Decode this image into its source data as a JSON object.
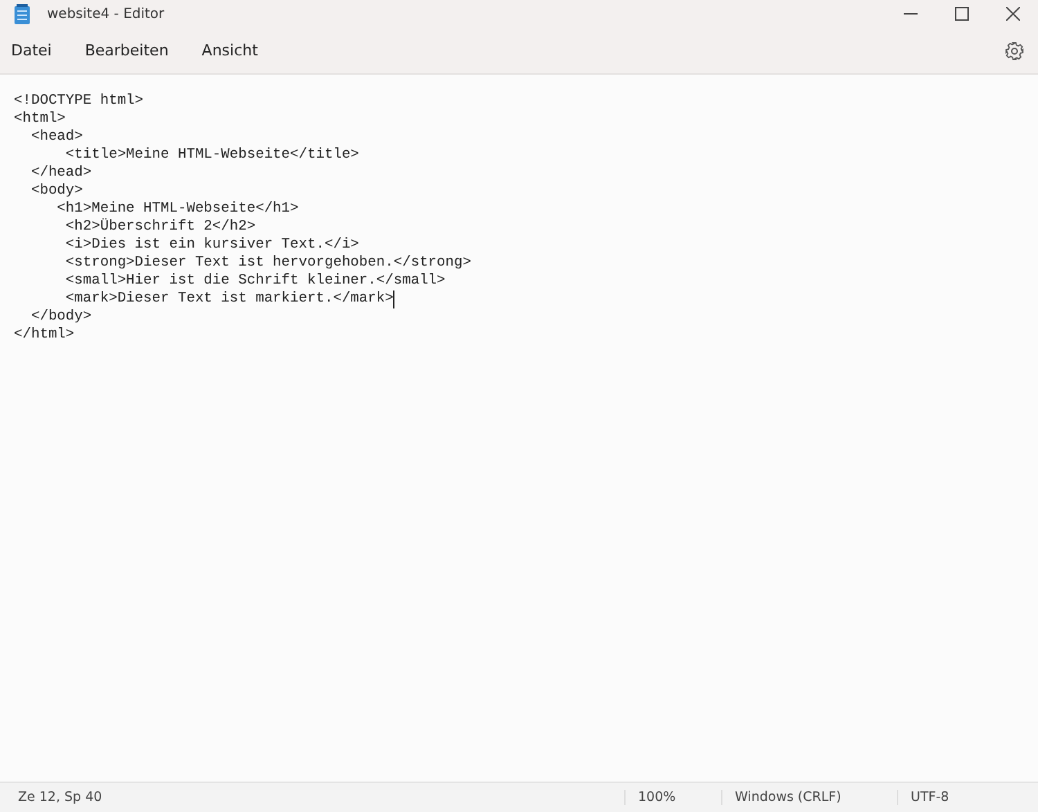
{
  "window": {
    "title": "website4 - Editor"
  },
  "menu": [
    "Datei",
    "Bearbeiten",
    "Ansicht"
  ],
  "editor": {
    "lines": [
      {
        "text": "<!DOCTYPE html>",
        "caret": false
      },
      {
        "text": "<html>",
        "caret": false
      },
      {
        "text": "  <head>",
        "caret": false
      },
      {
        "text": "      <title>Meine HTML-Webseite</title>",
        "caret": false
      },
      {
        "text": "  </head>",
        "caret": false
      },
      {
        "text": "  <body>",
        "caret": false
      },
      {
        "text": "     <h1>Meine HTML-Webseite</h1>",
        "caret": false
      },
      {
        "text": "      <h2>Überschrift 2</h2>",
        "caret": false
      },
      {
        "text": "      <i>Dies ist ein kursiver Text.</i>",
        "caret": false
      },
      {
        "text": "      <strong>Dieser Text ist hervorgehoben.</strong>",
        "caret": false
      },
      {
        "text": "      <small>Hier ist die Schrift kleiner.</small>",
        "caret": false
      },
      {
        "text": "      <mark>Dieser Text ist markiert.</mark>",
        "caret": true
      },
      {
        "text": "  </body>",
        "caret": false
      },
      {
        "text": "</html>",
        "caret": false
      }
    ]
  },
  "status_bar": {
    "position": "Ze 12, Sp 40",
    "zoom": "100%",
    "line_ending": "Windows (CRLF)",
    "encoding": "UTF-8"
  }
}
